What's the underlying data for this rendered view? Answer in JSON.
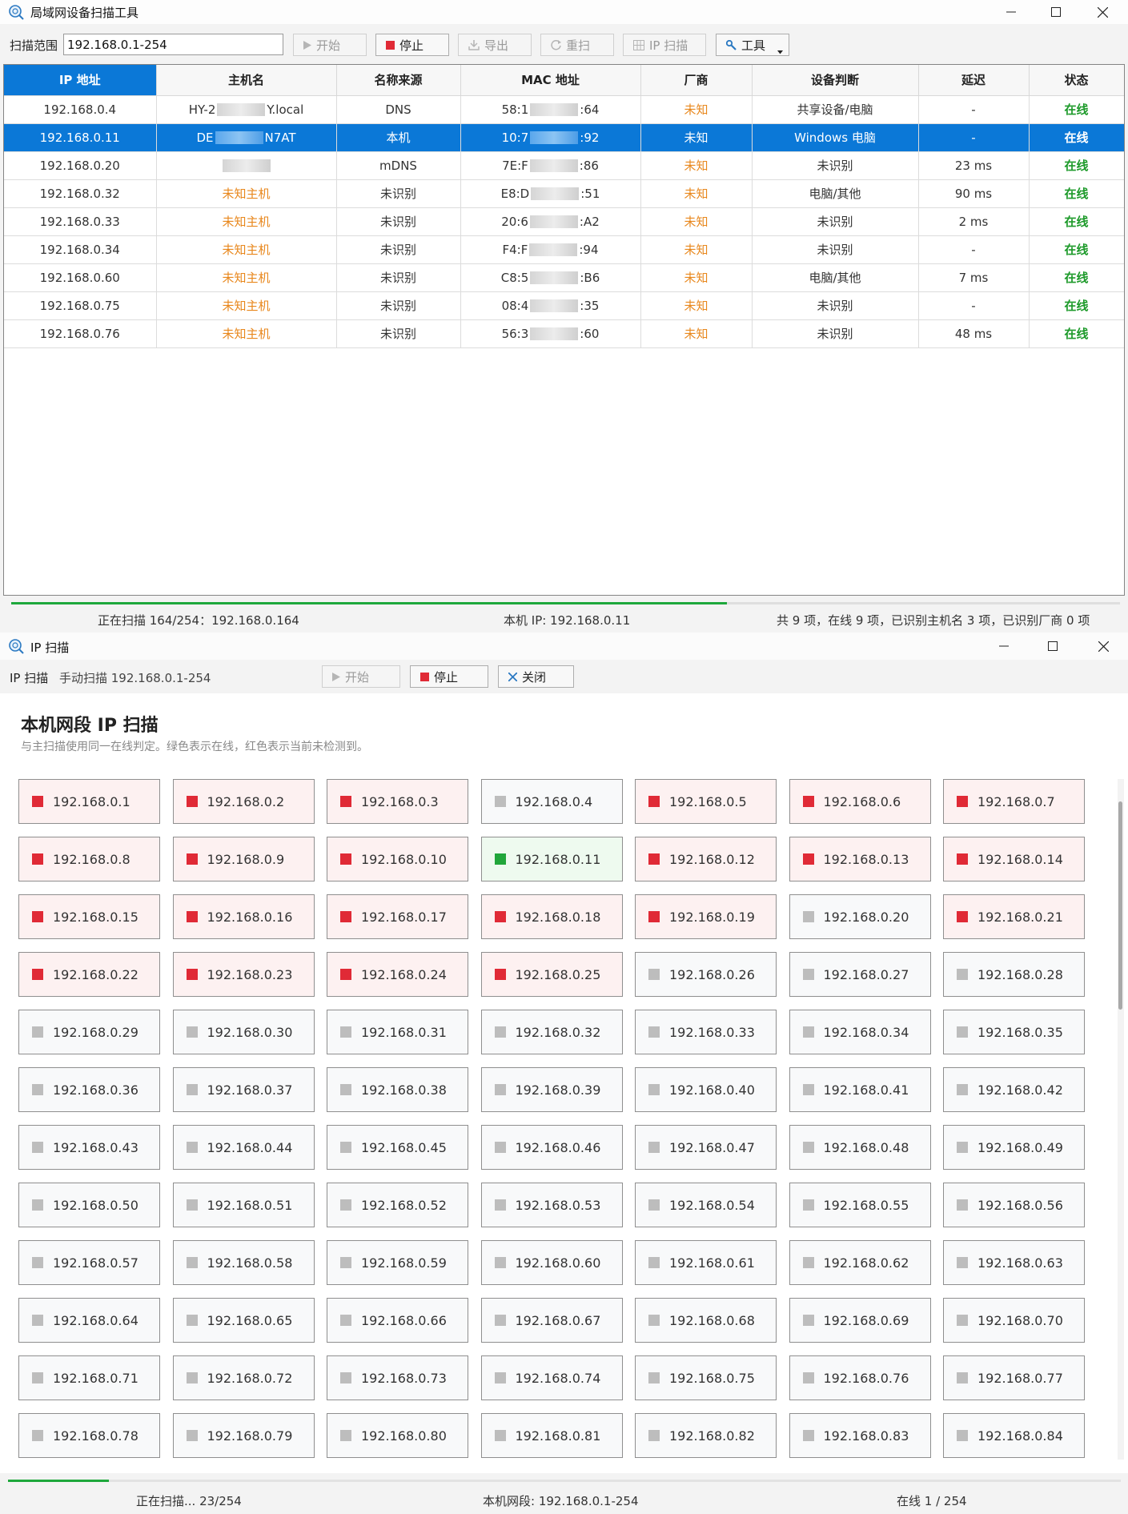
{
  "window1": {
    "title": "局域网设备扫描工具",
    "range_label": "扫描范围",
    "range_value": "192.168.0.1-254",
    "buttons": {
      "start": "开始",
      "stop": "停止",
      "export": "导出",
      "rescan": "重扫",
      "ipscan": "IP 扫描",
      "tools": "工具"
    },
    "columns": [
      "IP 地址",
      "主机名",
      "名称来源",
      "MAC 地址",
      "厂商",
      "设备判断",
      "延迟",
      "状态"
    ],
    "rows": [
      {
        "ip": "192.168.0.4",
        "host_a": "HY-2",
        "host_b": "Y.local",
        "source": "DNS",
        "mac_a": "58:1",
        "mac_b": ":64",
        "vendor": "未知",
        "device": "共享设备/电脑",
        "latency": "-",
        "status": "在线",
        "selected": false,
        "host_orange": false
      },
      {
        "ip": "192.168.0.11",
        "host_a": "DE",
        "host_b": "N7AT",
        "source": "本机",
        "mac_a": "10:7",
        "mac_b": ":92",
        "vendor": "未知",
        "device": "Windows 电脑",
        "latency": "-",
        "status": "在线",
        "selected": true,
        "host_orange": false
      },
      {
        "ip": "192.168.0.20",
        "host_a": "",
        "host_b": "",
        "source": "mDNS",
        "mac_a": "7E:F",
        "mac_b": ":86",
        "vendor": "未知",
        "device": "未识别",
        "latency": "23 ms",
        "status": "在线",
        "selected": false,
        "host_orange": false
      },
      {
        "ip": "192.168.0.32",
        "host_a": "未知主机",
        "host_b": "",
        "source": "未识别",
        "mac_a": "E8:D",
        "mac_b": ":51",
        "vendor": "未知",
        "device": "电脑/其他",
        "latency": "90 ms",
        "status": "在线",
        "selected": false,
        "host_orange": true
      },
      {
        "ip": "192.168.0.33",
        "host_a": "未知主机",
        "host_b": "",
        "source": "未识别",
        "mac_a": "20:6",
        "mac_b": ":A2",
        "vendor": "未知",
        "device": "未识别",
        "latency": "2 ms",
        "status": "在线",
        "selected": false,
        "host_orange": true
      },
      {
        "ip": "192.168.0.34",
        "host_a": "未知主机",
        "host_b": "",
        "source": "未识别",
        "mac_a": "F4:F",
        "mac_b": ":94",
        "vendor": "未知",
        "device": "未识别",
        "latency": "-",
        "status": "在线",
        "selected": false,
        "host_orange": true
      },
      {
        "ip": "192.168.0.60",
        "host_a": "未知主机",
        "host_b": "",
        "source": "未识别",
        "mac_a": "C8:5",
        "mac_b": ":B6",
        "vendor": "未知",
        "device": "电脑/其他",
        "latency": "7 ms",
        "status": "在线",
        "selected": false,
        "host_orange": true
      },
      {
        "ip": "192.168.0.75",
        "host_a": "未知主机",
        "host_b": "",
        "source": "未识别",
        "mac_a": "08:4",
        "mac_b": ":35",
        "vendor": "未知",
        "device": "未识别",
        "latency": "-",
        "status": "在线",
        "selected": false,
        "host_orange": true
      },
      {
        "ip": "192.168.0.76",
        "host_a": "未知主机",
        "host_b": "",
        "source": "未识别",
        "mac_a": "56:3",
        "mac_b": ":60",
        "vendor": "未知",
        "device": "未识别",
        "latency": "48 ms",
        "status": "在线",
        "selected": false,
        "host_orange": true
      }
    ],
    "status": {
      "progress": "正在扫描 164/254：192.168.0.164",
      "progress_fraction": 0.6457,
      "local_ip": "本机 IP: 192.168.0.11",
      "summary": "共 9 项，在线 9 项，已识别主机名 3 项，已识别厂商 0 项"
    }
  },
  "window2": {
    "title": "IP 扫描",
    "toolbar_title": "IP 扫描",
    "mode": "手动扫描 192.168.0.1-254",
    "buttons": {
      "start": "开始",
      "stop": "停止",
      "close": "关闭"
    },
    "heading": "本机网段 IP 扫描",
    "subheading": "与主扫描使用同一在线判定。绿色表示在线，红色表示当前未检测到。",
    "prefix": "192.168.0.",
    "states": [
      "red",
      "red",
      "red",
      "gray",
      "red",
      "red",
      "red",
      "red",
      "red",
      "red",
      "green",
      "red",
      "red",
      "red",
      "red",
      "red",
      "red",
      "red",
      "red",
      "gray",
      "red",
      "red",
      "red",
      "red",
      "red"
    ],
    "visible_count": 84,
    "status": {
      "progress": "正在扫描... 23/254",
      "progress_fraction": 0.0906,
      "segment": "本机网段: 192.168.0.1-254",
      "online": "在线 1 / 254"
    }
  },
  "colors": {
    "accent": "#0b78d7",
    "online": "#1d9a2a",
    "offline": "#e02a36",
    "unknown_vendor": "#e8871c",
    "pending": "#bdbdbd"
  }
}
